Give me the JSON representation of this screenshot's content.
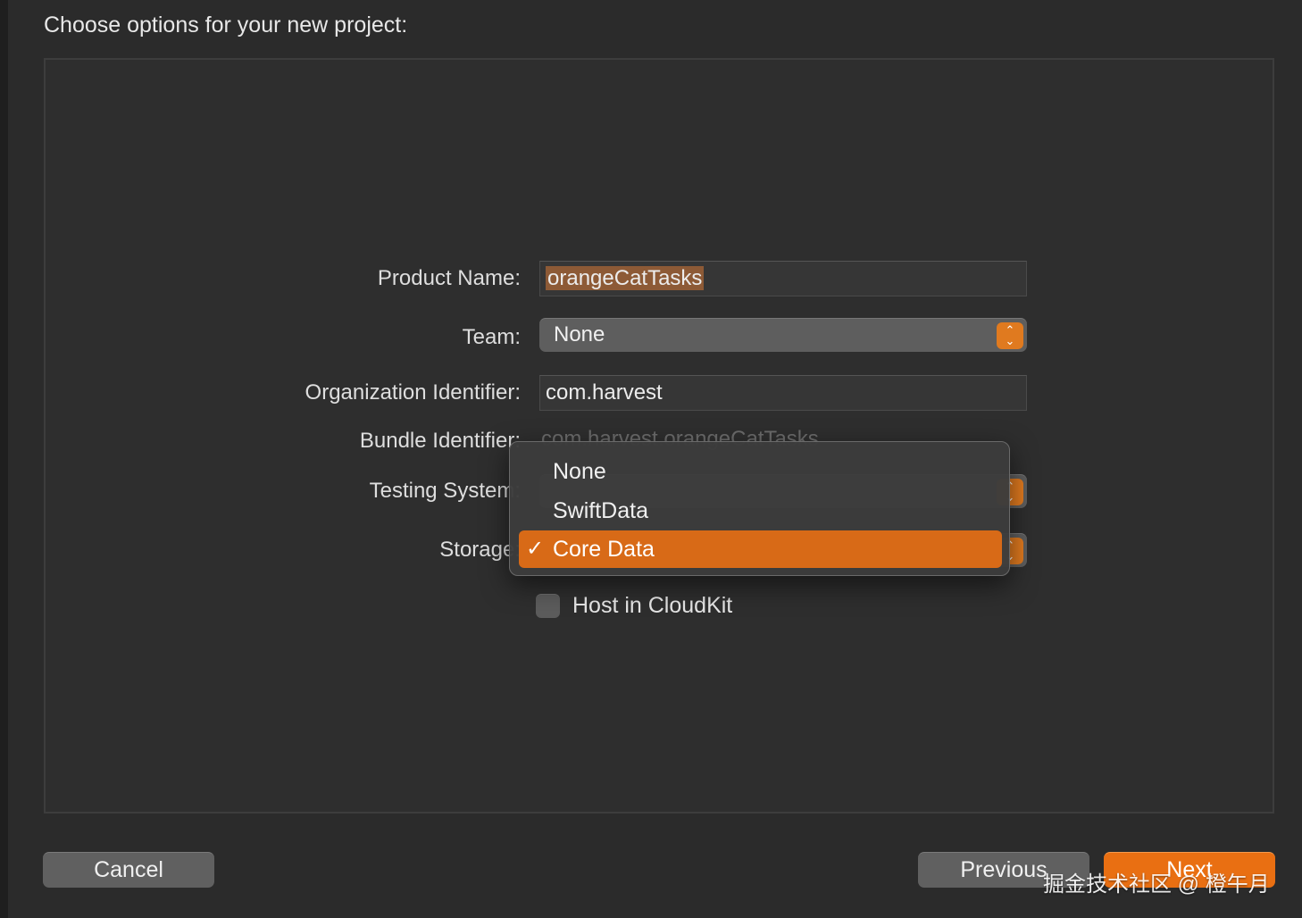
{
  "header": {
    "title": "Choose options for your new project:"
  },
  "form": {
    "product_name": {
      "label": "Product Name:",
      "value": "orangeCatTasks"
    },
    "team": {
      "label": "Team:",
      "value": "None"
    },
    "organization_identifier": {
      "label": "Organization Identifier:",
      "value": "com.harvest"
    },
    "bundle_identifier": {
      "label": "Bundle Identifier:",
      "value": "com.harvest.orangeCatTasks"
    },
    "testing_system": {
      "label": "Testing System:"
    },
    "storage": {
      "label": "Storage:"
    },
    "host_in_cloudkit": {
      "label": "Host in CloudKit",
      "checked": false
    }
  },
  "storage_menu": {
    "items": [
      "None",
      "SwiftData",
      "Core Data"
    ],
    "selected": "Core Data",
    "check_glyph": "✓"
  },
  "footer": {
    "cancel_label": "Cancel",
    "previous_label": "Previous",
    "next_label": "Next"
  },
  "watermark": "掘金技术社区 @ 橙午月",
  "colors": {
    "accent": "#e96f12",
    "background": "#2b2b2b",
    "panel": "#2e2e2e"
  },
  "icons": {
    "popup_stepper": "up-down-chevron-icon",
    "checkmark": "checkmark-icon"
  }
}
